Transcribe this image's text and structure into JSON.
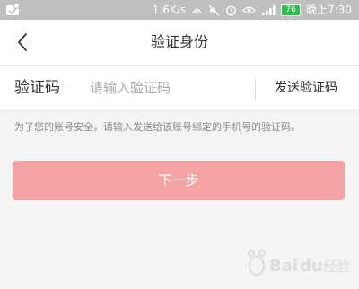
{
  "status_bar": {
    "network_speed": "1.6K/s",
    "battery_level": "76",
    "time": "晚上7:30",
    "icons": [
      "app-notification-icon",
      "nfc-icon",
      "mute-icon",
      "alarm-icon",
      "eye-icon",
      "signal-icon"
    ]
  },
  "header": {
    "title": "验证身份",
    "back_icon": "chevron-left-icon"
  },
  "form": {
    "code_label": "验证码",
    "code_placeholder": "请输入验证码",
    "code_value": "",
    "send_code_label": "发送验证码"
  },
  "hint": "为了您的账号安全，请输入发送给该账号绑定的手机号的验证码。",
  "next_button_label": "下一步",
  "colors": {
    "accent_disabled": "#f4a3a3",
    "status_bar_bg": "#bfbfbf",
    "battery_green": "#2fbf4b"
  }
}
